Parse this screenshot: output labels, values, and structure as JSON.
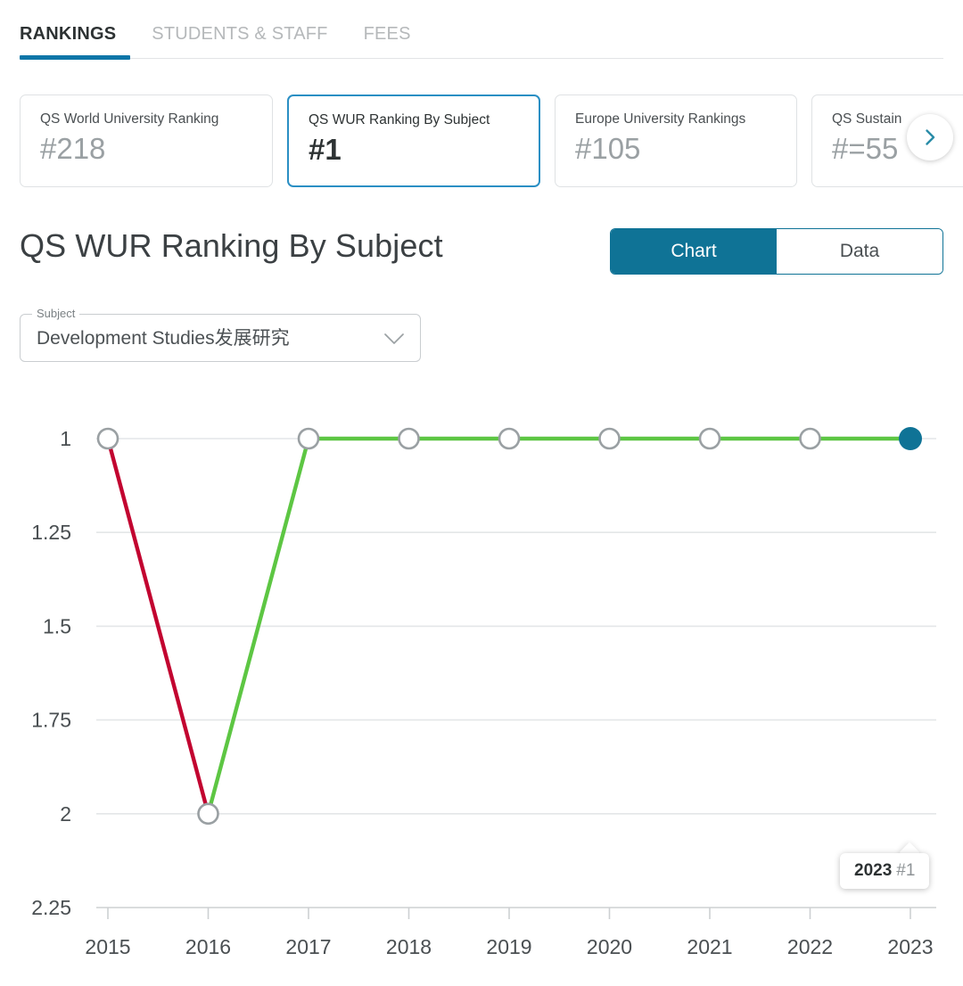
{
  "nav": {
    "tabs": [
      {
        "label": "RANKINGS",
        "active": true
      },
      {
        "label": "STUDENTS & STAFF",
        "active": false
      },
      {
        "label": "FEES",
        "active": false
      }
    ]
  },
  "ranking_cards": {
    "next_icon": "chevron-right-icon",
    "items": [
      {
        "title": "QS World University Ranking",
        "value": "#218",
        "selected": false
      },
      {
        "title": "QS WUR Ranking By Subject",
        "value": "#1",
        "selected": true
      },
      {
        "title": "Europe University Rankings",
        "value": "#105",
        "selected": false
      },
      {
        "title": "QS Sustain",
        "value": "#=55",
        "selected": false
      }
    ]
  },
  "section": {
    "title": "QS WUR Ranking By Subject",
    "view_toggle": [
      {
        "label": "Chart",
        "active": true
      },
      {
        "label": "Data",
        "active": false
      }
    ]
  },
  "subject_select": {
    "legend": "Subject",
    "value": "Development Studies发展研究",
    "chevron_icon": "chevron-down-icon"
  },
  "tooltip": {
    "year": "2023",
    "rank": "#1"
  },
  "colors": {
    "accent": "#0f7396",
    "tab_underline": "#0f76a8",
    "selected_card_border": "#2a8fc4",
    "line_down": "#c20430",
    "line_up": "#5dc643",
    "marker_stroke": "#9aa0a3",
    "gridline": "#e4e6e8"
  },
  "chart_data": {
    "type": "line",
    "title": "QS WUR Ranking By Subject",
    "xlabel": "",
    "ylabel": "",
    "x": [
      "2015",
      "2016",
      "2017",
      "2018",
      "2019",
      "2020",
      "2021",
      "2022",
      "2023"
    ],
    "values": [
      1,
      2,
      1,
      1,
      1,
      1,
      1,
      1,
      1
    ],
    "ytick_labels": [
      "1",
      "1.25",
      "1.5",
      "1.75",
      "2",
      "2.25"
    ],
    "ytick_values": [
      1,
      1.25,
      1.5,
      1.75,
      2,
      2.25
    ],
    "ylim": [
      1,
      2.25
    ],
    "y_inverted": true,
    "grid": true,
    "legend": "none",
    "segment_colors": [
      "#c20430",
      "#5dc643",
      "#5dc643",
      "#5dc643",
      "#5dc643",
      "#5dc643",
      "#5dc643",
      "#5dc643"
    ],
    "highlight_point": {
      "x": "2023",
      "y": 1,
      "color": "#0f7396"
    },
    "annotations": [
      {
        "text": "2023 #1",
        "x": "2023",
        "y": 1
      }
    ]
  }
}
